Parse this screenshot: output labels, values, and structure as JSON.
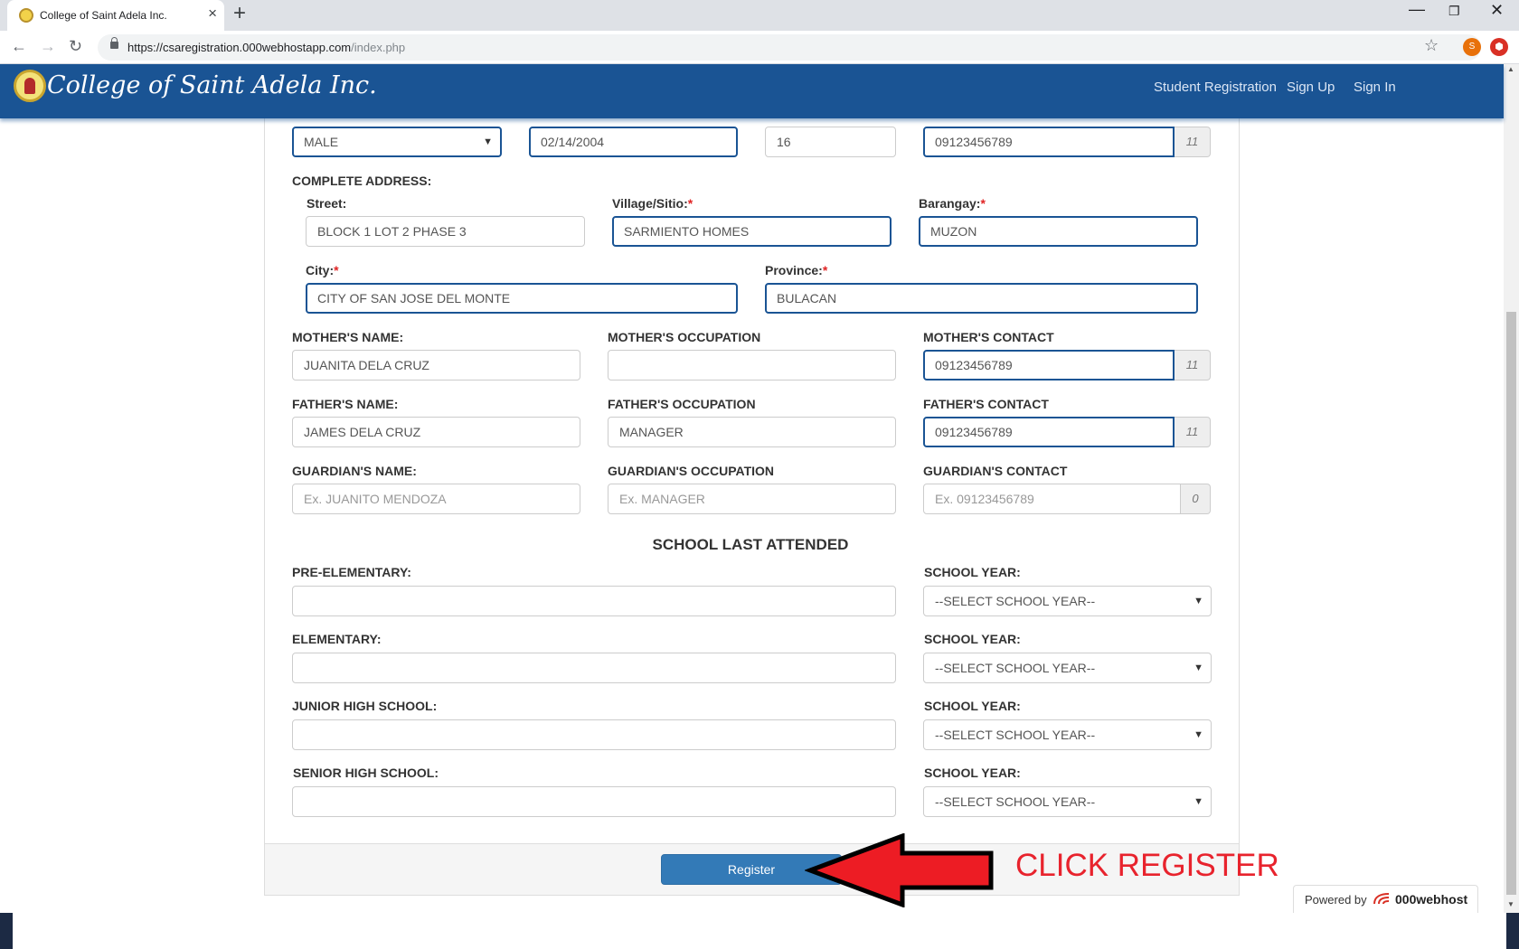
{
  "browser": {
    "tab_title": "College of Saint Adela Inc.",
    "close_glyph": "×",
    "new_tab_glyph": "+",
    "url_host": "https://csaregistration.000webhostapp.com",
    "url_path": "/index.php",
    "extension_1_letter": "S",
    "window_min_glyph": "—",
    "window_max_glyph": "❐",
    "window_close_glyph": "✕",
    "back_glyph": "←",
    "forward_glyph": "→",
    "reload_glyph": "↻",
    "star_glyph": "☆"
  },
  "site": {
    "brand": "College of Saint Adela Inc.",
    "nav_links": [
      "Student Registration",
      "Sign Up",
      "Sign In"
    ]
  },
  "form": {
    "row1": {
      "gender": "MALE",
      "birthdate": "02/14/2004",
      "age": "16",
      "contact": "09123456789",
      "contact_count": "11"
    },
    "address": {
      "heading": "COMPLETE ADDRESS:",
      "street_label": "Street:",
      "street": "BLOCK 1 LOT 2 PHASE 3",
      "village_label": "Village/Sitio:",
      "village": "SARMIENTO HOMES",
      "barangay_label": "Barangay:",
      "barangay": "MUZON",
      "city_label": "City:",
      "city": "CITY OF SAN JOSE DEL MONTE",
      "province_label": "Province:",
      "province": "BULACAN",
      "required_mark": "*"
    },
    "mother": {
      "name_label": "MOTHER'S NAME:",
      "name": "JUANITA DELA CRUZ",
      "occupation_label": "MOTHER'S OCCUPATION",
      "occupation": "",
      "contact_label": "MOTHER'S CONTACT",
      "contact": "09123456789",
      "contact_count": "11"
    },
    "father": {
      "name_label": "FATHER'S NAME:",
      "name": "JAMES DELA CRUZ",
      "occupation_label": "FATHER'S OCCUPATION",
      "occupation": "MANAGER",
      "contact_label": "FATHER'S CONTACT",
      "contact": "09123456789",
      "contact_count": "11"
    },
    "guardian": {
      "name_label": "GUARDIAN'S NAME:",
      "name_placeholder": "Ex. JUANITO MENDOZA",
      "occupation_label": "GUARDIAN'S OCCUPATION",
      "occupation_placeholder": "Ex. MANAGER",
      "contact_label": "GUARDIAN'S CONTACT",
      "contact_placeholder": "Ex. 09123456789",
      "contact_count": "0"
    },
    "school": {
      "title": "SCHOOL LAST ATTENDED",
      "year_label": "SCHOOL YEAR:",
      "year_select": "--SELECT SCHOOL YEAR--",
      "levels": [
        "PRE-ELEMENTARY:",
        "ELEMENTARY:",
        "JUNIOR HIGH SCHOOL:",
        "SENIOR HIGH SCHOOL:"
      ]
    },
    "register_label": "Register"
  },
  "annotation": {
    "text": "CLICK REGISTER",
    "color": "#e8232d"
  },
  "powered": {
    "prefix": "Powered by",
    "brand": "000webhost"
  },
  "colors": {
    "navbar": "#1a5494",
    "button": "#337ab7"
  }
}
